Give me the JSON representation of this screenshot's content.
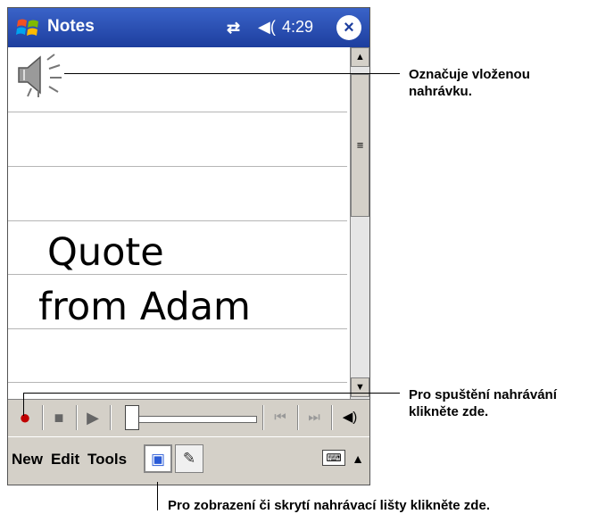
{
  "titlebar": {
    "app_title": "Notes",
    "time": "4:29",
    "close_symbol": "×",
    "logo_icon": "windows-flag-icon",
    "sync_icon": "⇄",
    "speaker_icon": "◀("
  },
  "note": {
    "line1": "Quote",
    "line2": "from Adam"
  },
  "recording_toolbar": {
    "record_icon": "●",
    "stop_icon": "■",
    "play_icon": "▶",
    "skip_back_icon": "⏮",
    "skip_forward_icon": "⏭",
    "volume_icon": "◀)"
  },
  "menubar": {
    "items": [
      "New",
      "Edit",
      "Tools"
    ],
    "recording_toggle_icon": "▣",
    "pen_icon": "✎",
    "keyboard_icon": "⌨",
    "sip_arrow": "▲"
  },
  "callouts": {
    "embedded_recording": [
      "Označuje vloženou",
      "nahrávku."
    ],
    "start_recording": [
      "Pro spuštění nahrávání",
      "klikněte zde."
    ],
    "toggle_recording_bar": "Pro zobrazení či skrytí nahrávací lišty klikněte zde."
  }
}
